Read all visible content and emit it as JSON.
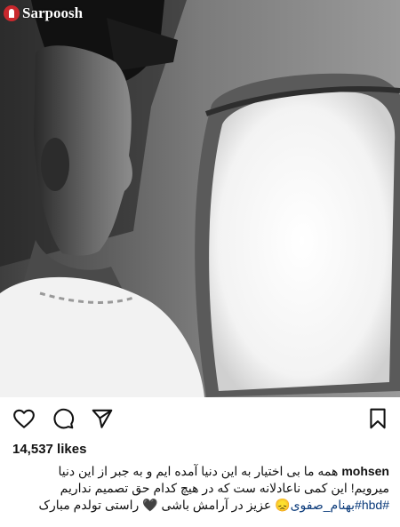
{
  "post": {
    "watermark": "Sarpoosh",
    "likes": "14,537 likes",
    "username": "mohsen",
    "caption_line1": "همه ما بی اختیار به این دنیا آمده ایم و به جبر از این دنیا",
    "caption_line2": "میرویم!  این کمی ناعادلانه ست که در هیچ کدام حق تصمیم نداریم",
    "hashtag1": "#hbd",
    "hashtag2": "#بهنام_صفوی",
    "emoji_sad": "😞",
    "caption_line3_text": " عزیز در آرامش باشی ",
    "emoji_heart": "🖤",
    "caption_line3_end": " راستی تولدم مبارک"
  },
  "icons": {
    "like": "heart-icon",
    "comment": "comment-icon",
    "share": "send-icon",
    "save": "bookmark-icon"
  },
  "colors": {
    "hashtag": "#0a3a7a",
    "watermark_brand": "#c9282d"
  }
}
